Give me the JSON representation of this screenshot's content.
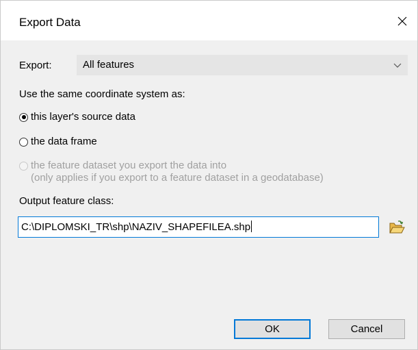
{
  "window": {
    "title": "Export Data",
    "close_icon": "close-icon"
  },
  "export": {
    "label": "Export:",
    "selected": "All features",
    "dropdown_icon": "chevron-down-icon"
  },
  "coordinate_system": {
    "heading": "Use the same coordinate system as:",
    "options": [
      {
        "label": "this layer's source data",
        "checked": true,
        "enabled": true
      },
      {
        "label": "the data frame",
        "checked": false,
        "enabled": true
      },
      {
        "label_line1": "the feature dataset you export the data into",
        "label_line2": "(only applies if you export to a feature dataset in a geodatabase)",
        "checked": false,
        "enabled": false
      }
    ]
  },
  "output": {
    "label": "Output feature class:",
    "value": "C:\\DIPLOMSKI_TR\\shp\\NAZIV_SHAPEFILEA.shp",
    "browse_icon": "open-folder-icon"
  },
  "buttons": {
    "ok": "OK",
    "cancel": "Cancel"
  },
  "colors": {
    "dialog_bg": "#f0f0f0",
    "titlebar_bg": "#ffffff",
    "accent": "#0078d7",
    "disabled_text": "#a0a0a0"
  }
}
